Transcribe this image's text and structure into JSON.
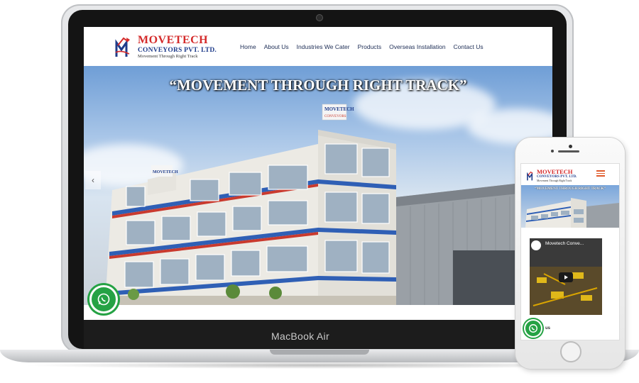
{
  "site": {
    "brand": "MOVETECH",
    "brand_sub": "CONVEYORS PVT. LTD.",
    "tagline": "Movement Through Right Track",
    "nav": [
      "Home",
      "About Us",
      "Industries We Cater",
      "Products",
      "Overseas Installation",
      "Contact Us"
    ],
    "hero_headline": "“MOVEMENT THROUGH RIGHT TRACK”",
    "building_sign_brand": "MOVETECH",
    "building_sign_sub": "CONVEYORS",
    "prev_arrow": "‹"
  },
  "laptop": {
    "label": "MacBook Air"
  },
  "phone": {
    "video_title": "Movetech Conve...",
    "bottom_text": "us"
  },
  "colors": {
    "brand_red": "#d42a2a",
    "brand_blue": "#1f3c8a",
    "whatsapp_green": "#25a244",
    "menu_accent": "#e05a2a"
  },
  "icons": [
    "whatsapp-icon",
    "hamburger-menu-icon",
    "play-icon",
    "chevron-left-icon",
    "logo-mark-icon"
  ]
}
